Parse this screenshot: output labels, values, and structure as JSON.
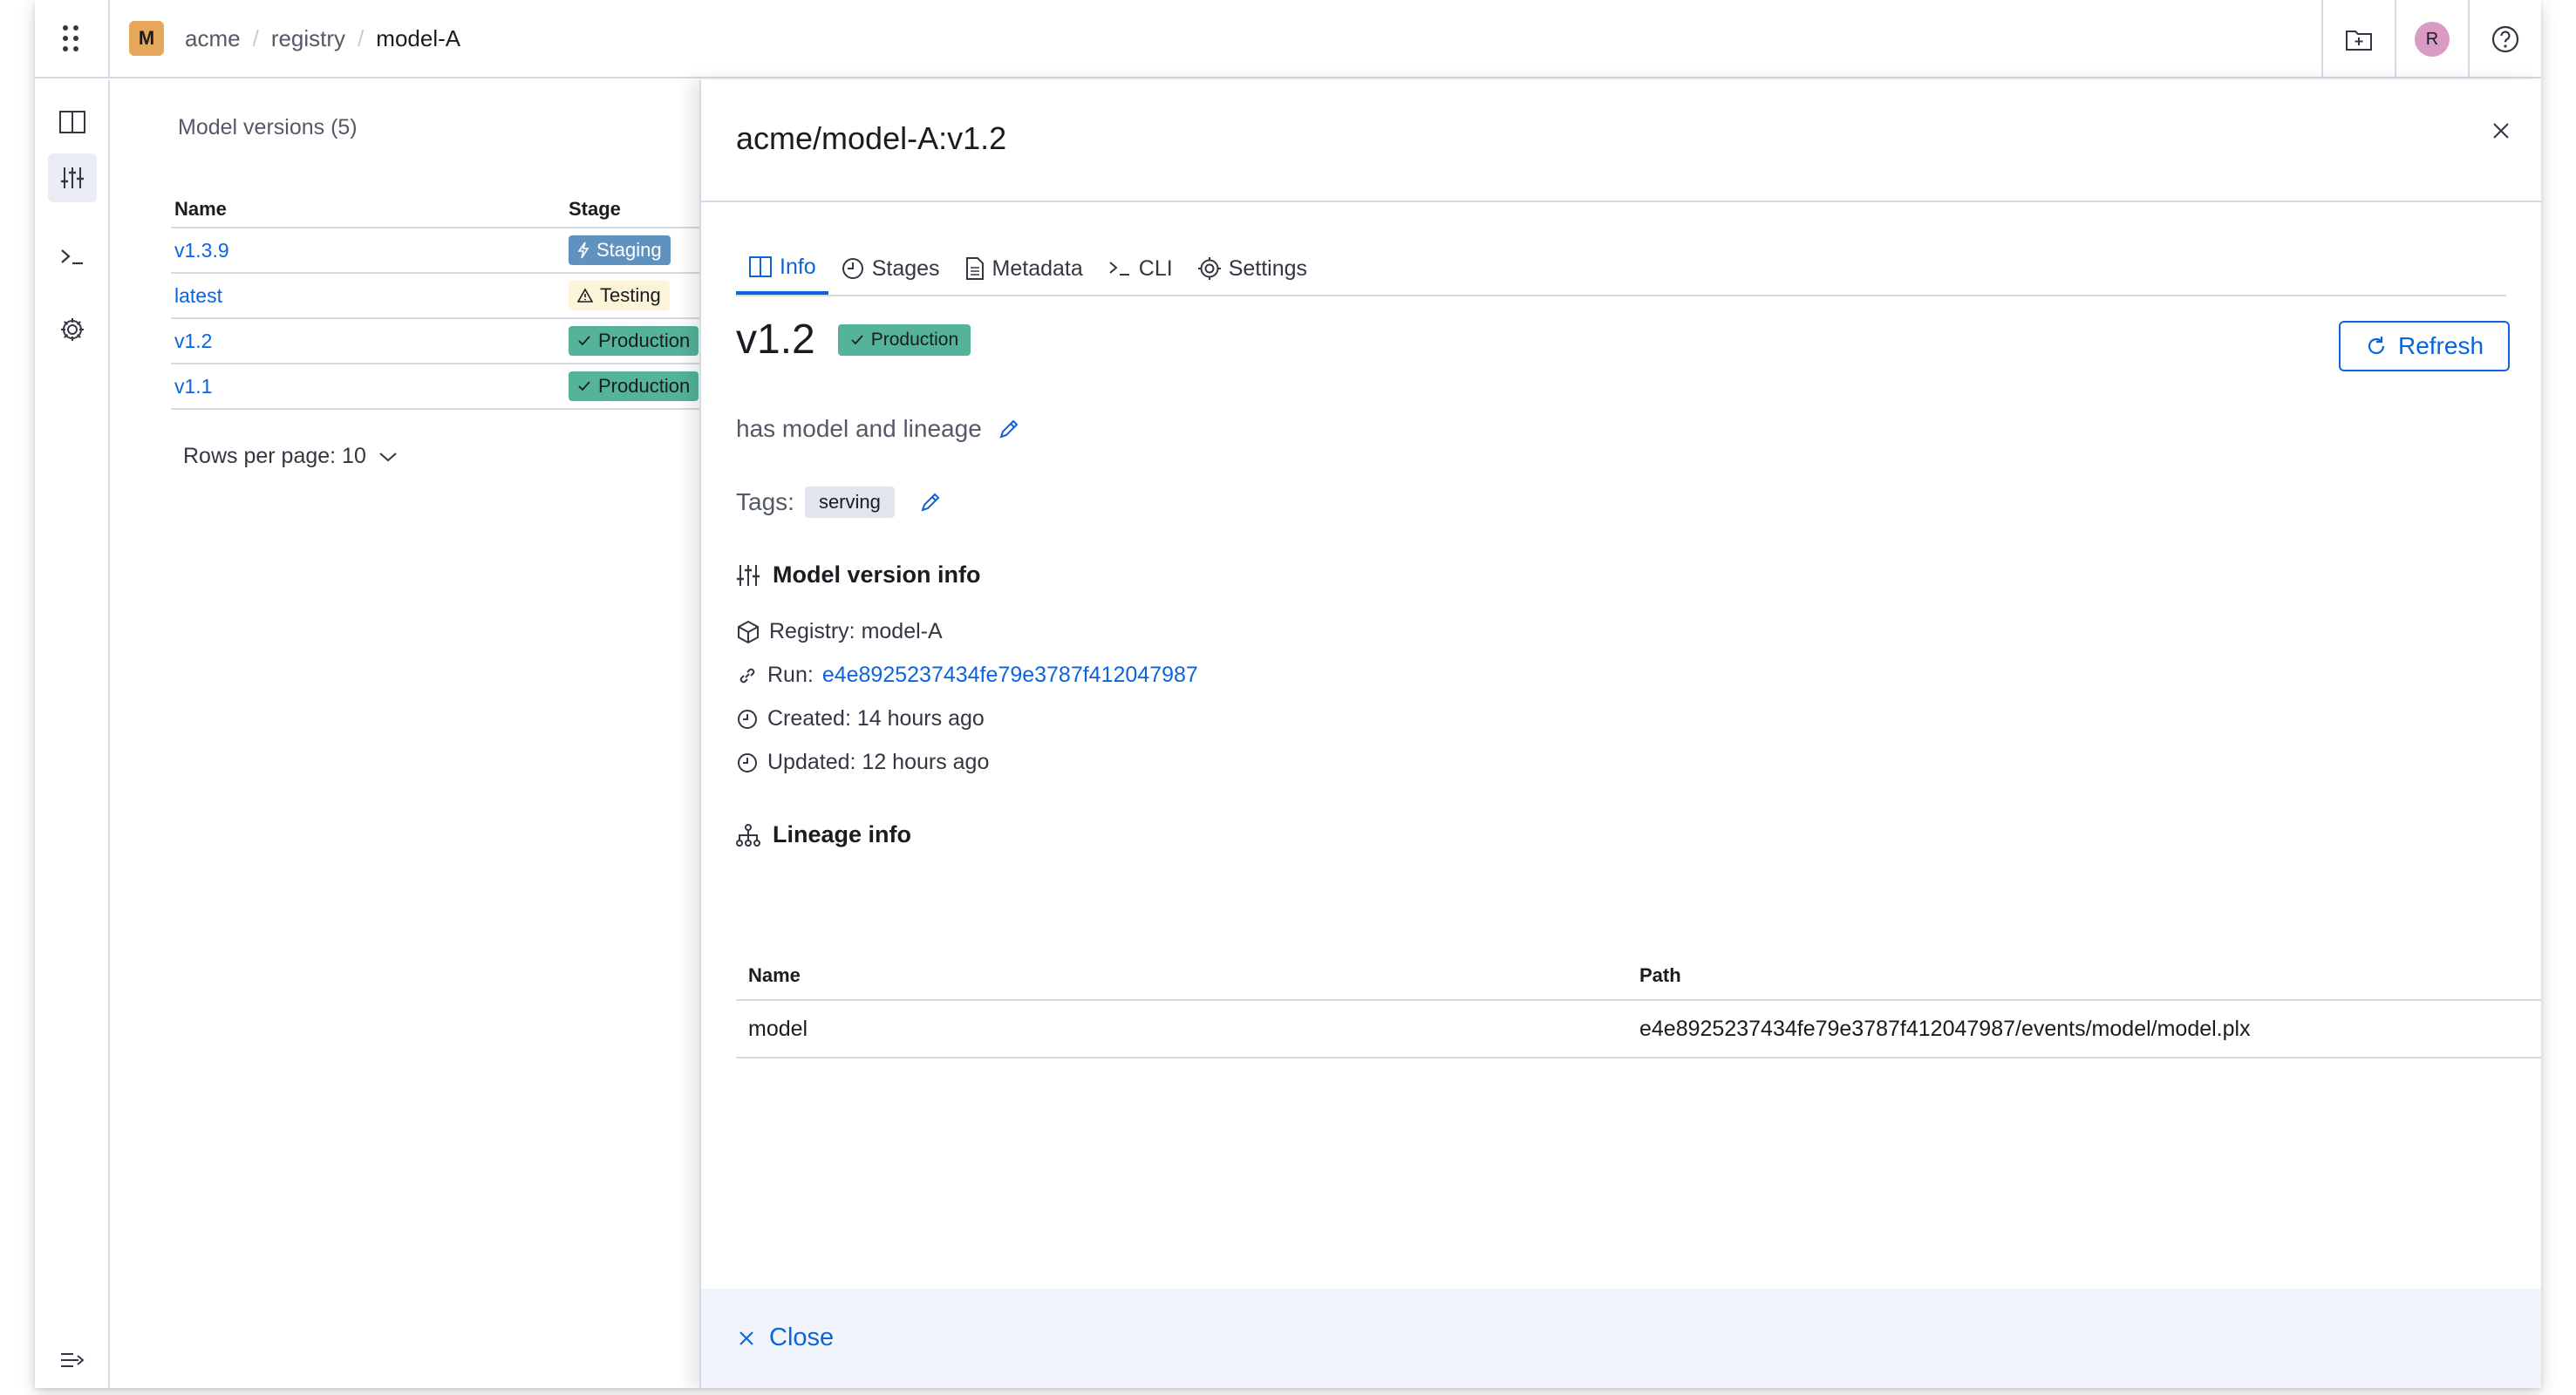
{
  "header": {
    "space_initial": "M",
    "breadcrumb": [
      "acme",
      "registry",
      "model-A"
    ],
    "separator": "/",
    "user_initial": "R"
  },
  "list": {
    "title": "Model versions (5)",
    "columns": {
      "name": "Name",
      "stage": "Stage"
    },
    "rows": [
      {
        "name": "v1.3.9",
        "stage": "Staging",
        "stage_icon": "bolt-icon"
      },
      {
        "name": "latest",
        "stage": "Testing",
        "stage_icon": "warning-icon"
      },
      {
        "name": "v1.2",
        "stage": "Production",
        "stage_icon": "check-icon"
      },
      {
        "name": "v1.1",
        "stage": "Production",
        "stage_icon": "check-icon"
      }
    ],
    "rows_per_page": "Rows per page: 10"
  },
  "flyout": {
    "title": "acme/model-A:v1.2",
    "tabs": [
      "Info",
      "Stages",
      "Metadata",
      "CLI",
      "Settings"
    ],
    "active_tab": "Info",
    "version": "v1.2",
    "stage_badge": "Production",
    "refresh_label": "Refresh",
    "description": "has model and lineage",
    "tags_label": "Tags:",
    "tags": [
      "serving"
    ],
    "model_info_title": "Model version info",
    "registry": "Registry: model-A",
    "run_label": "Run:",
    "run_id": "e4e8925237434fe79e3787f412047987",
    "created": "Created: 14 hours ago",
    "updated": "Updated: 12 hours ago",
    "lineage_title": "Lineage info",
    "lineage_columns": {
      "name": "Name",
      "path": "Path"
    },
    "lineage_rows": [
      {
        "name": "model",
        "path": "e4e8925237434fe79e3787f412047987/events/model/model.plx"
      }
    ],
    "close_label": "Close"
  },
  "colors": {
    "accent": "#0b64dd",
    "staging": "#6092c0",
    "testing": "#fdf3d8",
    "production": "#54b399",
    "space_badge": "#e7a75a",
    "avatar": "#d99ac4"
  }
}
